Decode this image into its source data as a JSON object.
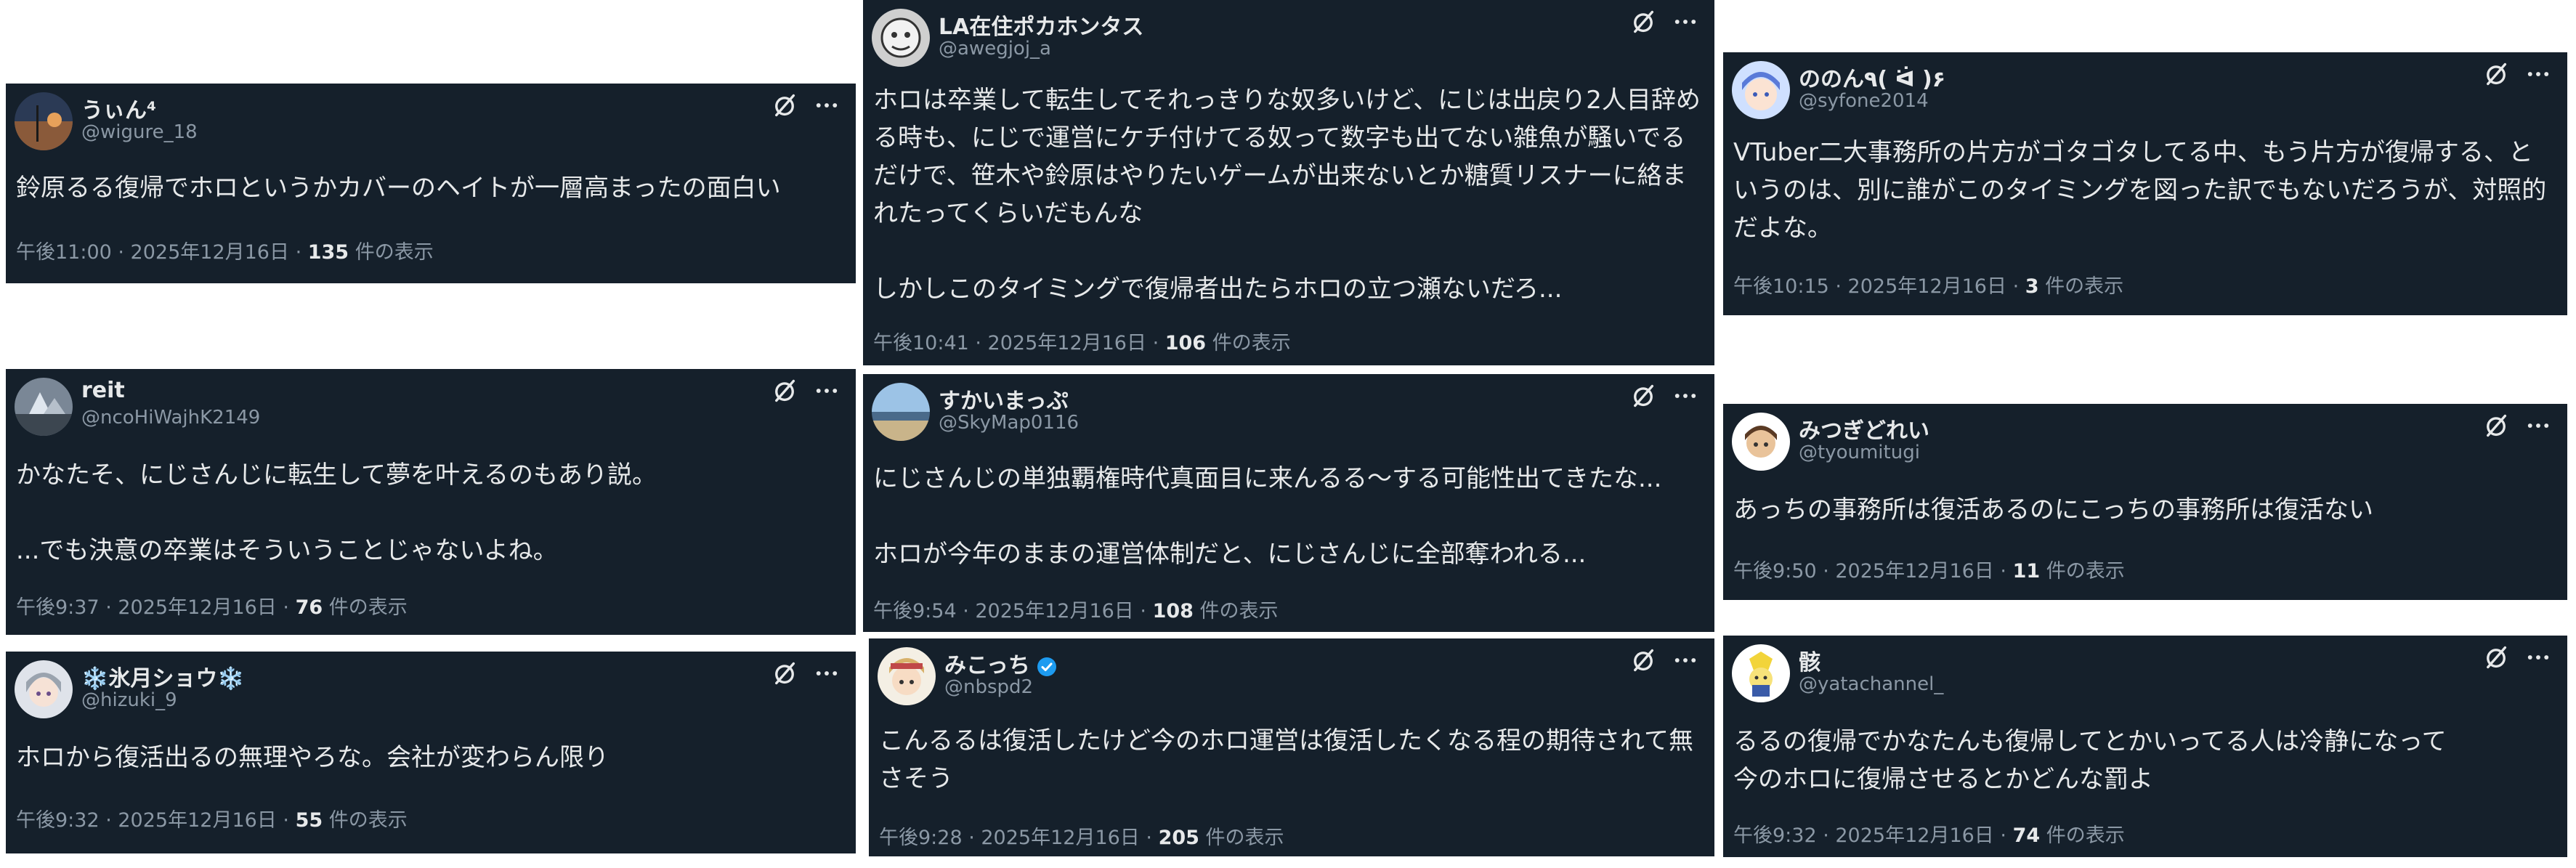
{
  "colors": {
    "card_bg": "#15202b",
    "text": "#e7e9ea",
    "muted": "#8b98a5",
    "verified": "#1d9bf0"
  },
  "icons": {
    "grok": "grok-icon",
    "more": "more-icon",
    "verified": "verified-badge-icon"
  },
  "views_suffix": "件の表示",
  "posts": [
    {
      "name": "うぃん⁴",
      "handle": "@wigure_18",
      "text": "鈴原るる復帰でホロというかカバーのヘイトが一層高まったの面白い",
      "time": "午後11:00 · 2025年12月16日 · ",
      "views": "135"
    },
    {
      "name": "LA在住ポカホンタス",
      "handle": "@awegjoj_a",
      "text": "ホロは卒業して転生してそれっきりな奴多いけど、にじは出戻り2人目辞める時も、にじで運営にケチ付けてる奴って数字も出てない雑魚が騒いでるだけで、笹木や鈴原はやりたいゲームが出来ないとか糖質リスナーに絡まれたってくらいだもんな\n\nしかしこのタイミングで復帰者出たらホロの立つ瀬ないだろ...",
      "time": "午後10:41 · 2025年12月16日 · ",
      "views": "106"
    },
    {
      "name": "ののん٩( ᐛ )۶",
      "handle": "@syfone2014",
      "text": "VTuber二大事務所の片方がゴタゴタしてる中、もう片方が復帰する、というのは、別に誰がこのタイミングを図った訳でもないだろうが、対照的だよな。",
      "time": "午後10:15 · 2025年12月16日 · ",
      "views": "3"
    },
    {
      "name": "reit",
      "handle": "@ncoHiWajhK2149",
      "text": "かなたそ、にじさんじに転生して夢を叶えるのもあり説。\n\n...でも決意の卒業はそういうことじゃないよね。",
      "time": "午後9:37 · 2025年12月16日 · ",
      "views": "76"
    },
    {
      "name": "すかいまっぷ",
      "handle": "@SkyMap0116",
      "text": "にじさんじの単独覇権時代真面目に来んるる～する可能性出てきたな...\n\nホロが今年のままの運営体制だと、にじさんじに全部奪われる...",
      "time": "午後9:54 · 2025年12月16日 · ",
      "views": "108"
    },
    {
      "name": "みつぎどれい",
      "handle": "@tyoumitugi",
      "text": "あっちの事務所は復活あるのにこっちの事務所は復活ない",
      "time": "午後9:50 · 2025年12月16日 · ",
      "views": "11"
    },
    {
      "name": "❄️氷月ショウ❄️",
      "handle": "@hizuki_9",
      "text": "ホロから復活出るの無理やろな。会社が変わらん限り",
      "time": "午後9:32 · 2025年12月16日 · ",
      "views": "55"
    },
    {
      "name": "みこっち",
      "handle": "@nbspd2",
      "text": "こんるるは復活したけど今のホロ運営は復活したくなる程の期待されて無さそう",
      "time": "午後9:28 · 2025年12月16日 · ",
      "views": "205"
    },
    {
      "name": "骸",
      "handle": "@yatachannel_",
      "text": "るるの復帰でかなたんも復帰してとかいってる人は冷静になって\n今のホロに復帰させるとかどんな罰よ",
      "time": "午後9:32 · 2025年12月16日 · ",
      "views": "74"
    }
  ]
}
